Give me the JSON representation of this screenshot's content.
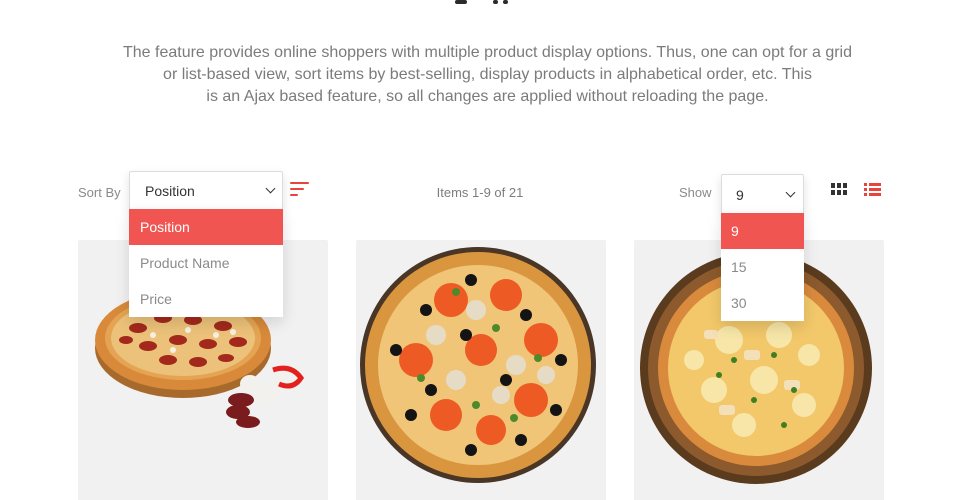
{
  "page": {
    "description_lines": [
      "The feature provides online shoppers with multiple product display options. Thus, one can opt for a grid",
      "or list-based view, sort items by best-selling, display products in alphabetical order, etc. This",
      "is an Ajax based feature, so all changes are applied without reloading the page."
    ]
  },
  "toolbar": {
    "sort_label": "Sort By",
    "sort_selected": "Position",
    "sort_options": [
      "Position",
      "Product Name",
      "Price"
    ],
    "items_count": "Items 1-9 of 21",
    "show_label": "Show",
    "show_selected": "9",
    "show_options": [
      "9",
      "15",
      "30"
    ],
    "accent_color": "#f05551",
    "icons": [
      "sort-direction-icon",
      "grid-view-icon",
      "list-view-icon",
      "chevron-down-icon"
    ]
  },
  "products": [
    {
      "image": "pepperoni-pizza-with-mushrooms-and-peppers"
    },
    {
      "image": "pizza-with-tomatoes-olives-and-mushrooms"
    },
    {
      "image": "pineapple-chicken-pizza-on-wooden-board"
    }
  ]
}
